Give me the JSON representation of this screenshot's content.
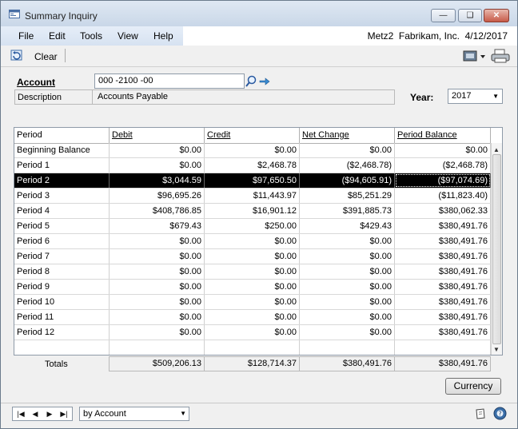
{
  "window": {
    "title": "Summary Inquiry"
  },
  "menu": {
    "items": [
      "File",
      "Edit",
      "Tools",
      "View",
      "Help"
    ],
    "context": "Metz2  Fabrikam, Inc.  4/12/2017"
  },
  "toolbar": {
    "clear_label": "Clear"
  },
  "form": {
    "account_label": "Account",
    "account_value": "000 -2100 -00",
    "description_label": "Description",
    "description_value": "Accounts Payable",
    "year_label": "Year:",
    "year_value": "2017"
  },
  "grid": {
    "headers": [
      "Period",
      "Debit",
      "Credit",
      "Net Change",
      "Period Balance"
    ],
    "rows": [
      {
        "period": "Beginning Balance",
        "debit": "$0.00",
        "credit": "$0.00",
        "net": "$0.00",
        "balance": "$0.00"
      },
      {
        "period": "Period 1",
        "debit": "$0.00",
        "credit": "$2,468.78",
        "net": "($2,468.78)",
        "balance": "($2,468.78)"
      },
      {
        "period": "Period 2",
        "debit": "$3,044.59",
        "credit": "$97,650.50",
        "net": "($94,605.91)",
        "balance": "($97,074.69)"
      },
      {
        "period": "Period 3",
        "debit": "$96,695.26",
        "credit": "$11,443.97",
        "net": "$85,251.29",
        "balance": "($11,823.40)"
      },
      {
        "period": "Period 4",
        "debit": "$408,786.85",
        "credit": "$16,901.12",
        "net": "$391,885.73",
        "balance": "$380,062.33"
      },
      {
        "period": "Period 5",
        "debit": "$679.43",
        "credit": "$250.00",
        "net": "$429.43",
        "balance": "$380,491.76"
      },
      {
        "period": "Period 6",
        "debit": "$0.00",
        "credit": "$0.00",
        "net": "$0.00",
        "balance": "$380,491.76"
      },
      {
        "period": "Period 7",
        "debit": "$0.00",
        "credit": "$0.00",
        "net": "$0.00",
        "balance": "$380,491.76"
      },
      {
        "period": "Period 8",
        "debit": "$0.00",
        "credit": "$0.00",
        "net": "$0.00",
        "balance": "$380,491.76"
      },
      {
        "period": "Period 9",
        "debit": "$0.00",
        "credit": "$0.00",
        "net": "$0.00",
        "balance": "$380,491.76"
      },
      {
        "period": "Period 10",
        "debit": "$0.00",
        "credit": "$0.00",
        "net": "$0.00",
        "balance": "$380,491.76"
      },
      {
        "period": "Period 11",
        "debit": "$0.00",
        "credit": "$0.00",
        "net": "$0.00",
        "balance": "$380,491.76"
      },
      {
        "period": "Period 12",
        "debit": "$0.00",
        "credit": "$0.00",
        "net": "$0.00",
        "balance": "$380,491.76"
      }
    ],
    "selected_row": 2
  },
  "totals": {
    "label": "Totals",
    "debit": "$509,206.13",
    "credit": "$128,714.37",
    "net": "$380,491.76",
    "balance": "$380,491.76"
  },
  "buttons": {
    "currency_label": "Currency"
  },
  "statusbar": {
    "sort_value": "by Account"
  },
  "icons": {
    "window": "window-app-icon",
    "clear": "clear-undo-icon",
    "lookup": "lookup-magnifier-icon",
    "go": "go-arrow-icon",
    "toolbar_right_1": "reports-icon",
    "toolbar_right_2": "printer-icon",
    "status_1": "note-icon",
    "status_2": "help-icon"
  }
}
